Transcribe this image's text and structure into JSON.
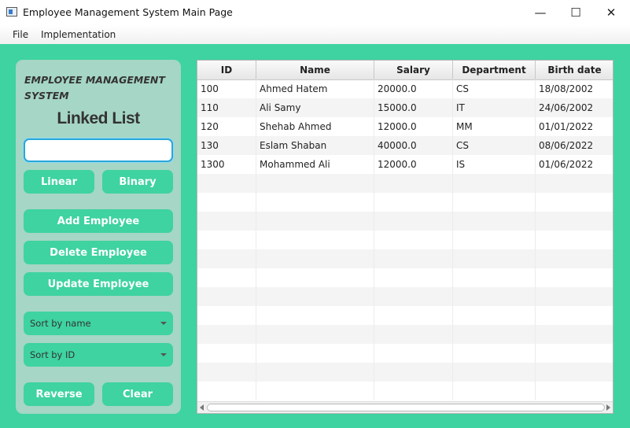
{
  "window": {
    "title": "Employee Management System Main Page",
    "minimize": "—",
    "maximize": "☐",
    "close": "✕"
  },
  "menu": [
    "File",
    "Implementation"
  ],
  "sidebar": {
    "title": "EMPLOYEE MANAGEMENT SYSTEM",
    "subtitle": "Linked List",
    "search_value": "",
    "linear_label": "Linear",
    "binary_label": "Binary",
    "add_label": "Add Employee",
    "delete_label": "Delete Employee",
    "update_label": "Update Employee",
    "sort_name_label": "Sort by name",
    "sort_id_label": "Sort by ID",
    "reverse_label": "Reverse",
    "clear_label": "Clear"
  },
  "table": {
    "columns": [
      "ID",
      "Name",
      "Salary",
      "Department",
      "Birth date"
    ],
    "rows": [
      [
        "100",
        "Ahmed Hatem",
        "20000.0",
        "CS",
        "18/08/2002"
      ],
      [
        "110",
        "Ali Samy",
        "15000.0",
        "IT",
        "24/06/2002"
      ],
      [
        "120",
        "Shehab Ahmed",
        "12000.0",
        "MM",
        "01/01/2022"
      ],
      [
        "130",
        "Eslam Shaban",
        "40000.0",
        "CS",
        "08/06/2022"
      ],
      [
        "1300",
        "Mohammed Ali",
        "12000.0",
        "IS",
        "01/06/2022"
      ]
    ]
  },
  "colors": {
    "accent": "#3ed3a0",
    "panel": "#a6d6c5",
    "search_focus": "#2aa6d8"
  }
}
